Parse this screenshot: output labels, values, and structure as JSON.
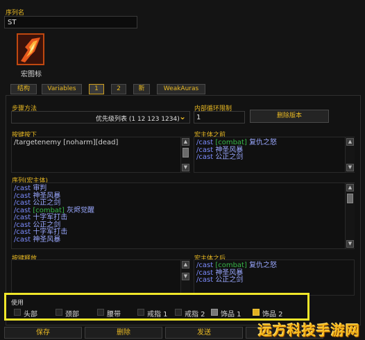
{
  "sequence_name": {
    "label": "序列名",
    "value": "ST"
  },
  "macro_icon": {
    "label": "宏图标"
  },
  "tabs": [
    "结构",
    "Variables",
    "1",
    "2",
    "新",
    "WeakAuras"
  ],
  "step_function": {
    "label": "步骤方法",
    "selected": "优先级列表 (1 12 123 1234)"
  },
  "inner_loop": {
    "label": "内部循环限制",
    "value": "1",
    "delete_version_label": "删除版本"
  },
  "key_press": {
    "label": "按键按下",
    "lines": [
      "/targetenemy [noharm][dead]"
    ]
  },
  "pre_macro": {
    "label": "宏主体之前",
    "lines": [
      {
        "cmd": "/cast ",
        "mod": "[combat]",
        "name": "复仇之怒"
      },
      {
        "cmd": "/cast ",
        "mod": "",
        "name": "神圣风暴"
      },
      {
        "cmd": "/cast ",
        "mod": "",
        "name": "公正之剑"
      }
    ]
  },
  "sequence_body": {
    "label": "序列(宏主体)",
    "lines": [
      {
        "cmd": "/cast ",
        "mod": "",
        "name": "审判"
      },
      {
        "cmd": "/cast ",
        "mod": "",
        "name": "神圣风暴"
      },
      {
        "cmd": "/cast ",
        "mod": "",
        "name": "公正之剑"
      },
      {
        "cmd": "/cast ",
        "mod": "[combat]",
        "name": "灰烬觉醒"
      },
      {
        "cmd": "/cast ",
        "mod": "",
        "name": "十字军打击"
      },
      {
        "cmd": "/cast ",
        "mod": "",
        "name": "公正之剑"
      },
      {
        "cmd": "/cast ",
        "mod": "",
        "name": "十字军打击"
      },
      {
        "cmd": "/cast ",
        "mod": "",
        "name": "神圣风暴"
      }
    ]
  },
  "key_release": {
    "label": "按键释放"
  },
  "post_macro": {
    "label": "宏主体之后",
    "lines": [
      {
        "cmd": "/cast ",
        "mod": "[combat]",
        "name": "复仇之怒"
      },
      {
        "cmd": "/cast ",
        "mod": "",
        "name": "神圣风暴"
      },
      {
        "cmd": "/cast ",
        "mod": "",
        "name": "公正之剑"
      }
    ]
  },
  "use_section": {
    "label": "使用",
    "items": [
      {
        "label": "头部",
        "state": "unchecked"
      },
      {
        "label": "颈部",
        "state": "unchecked"
      },
      {
        "label": "腰带",
        "state": "unchecked"
      },
      {
        "label": "戒指 1",
        "state": "unchecked"
      },
      {
        "label": "戒指 2",
        "state": "unchecked"
      },
      {
        "label": "饰品 1",
        "state": "checked-gray"
      },
      {
        "label": "饰品 2",
        "state": "checked-gold"
      }
    ]
  },
  "bottom_buttons": [
    "保存",
    "删除",
    "发送"
  ],
  "watermark": "远方科技手游网",
  "colors": {
    "accent": "#e9b923",
    "highlight_box": "#f0e62a",
    "macro_text": "#7c8cff",
    "modifier": "#36b548"
  }
}
